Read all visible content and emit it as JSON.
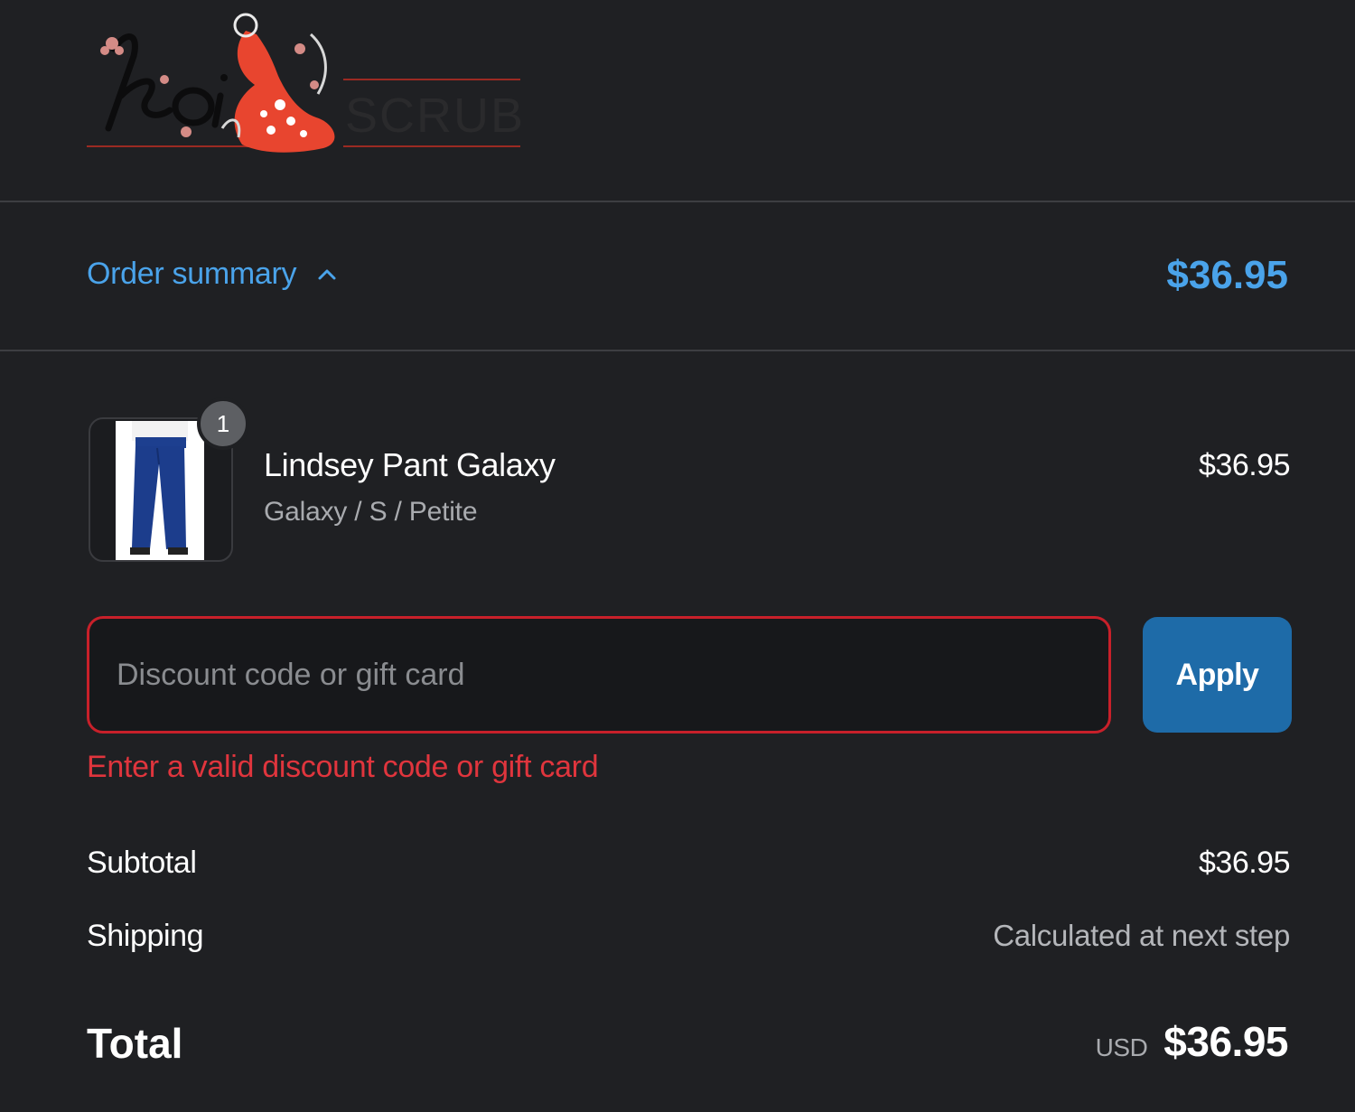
{
  "brand": {
    "logo_script": "koi",
    "logo_word": "SCRUBS",
    "accent_color": "#e8452f"
  },
  "order_summary": {
    "toggle_label": "Order summary",
    "toggle_icon": "chevron-up-icon",
    "total": "$36.95",
    "link_color": "#4aa3ea"
  },
  "line_item": {
    "quantity": "1",
    "name": "Lindsey Pant Galaxy",
    "variant": "Galaxy / S / Petite",
    "price": "$36.95"
  },
  "discount": {
    "placeholder": "Discount code or gift card",
    "value": "",
    "apply_label": "Apply",
    "error": "Enter a valid discount code or gift card",
    "error_color": "#e0353d"
  },
  "totals": {
    "subtotal_label": "Subtotal",
    "subtotal_value": "$36.95",
    "shipping_label": "Shipping",
    "shipping_value": "Calculated at next step",
    "total_label": "Total",
    "currency": "USD",
    "total_value": "$36.95"
  }
}
